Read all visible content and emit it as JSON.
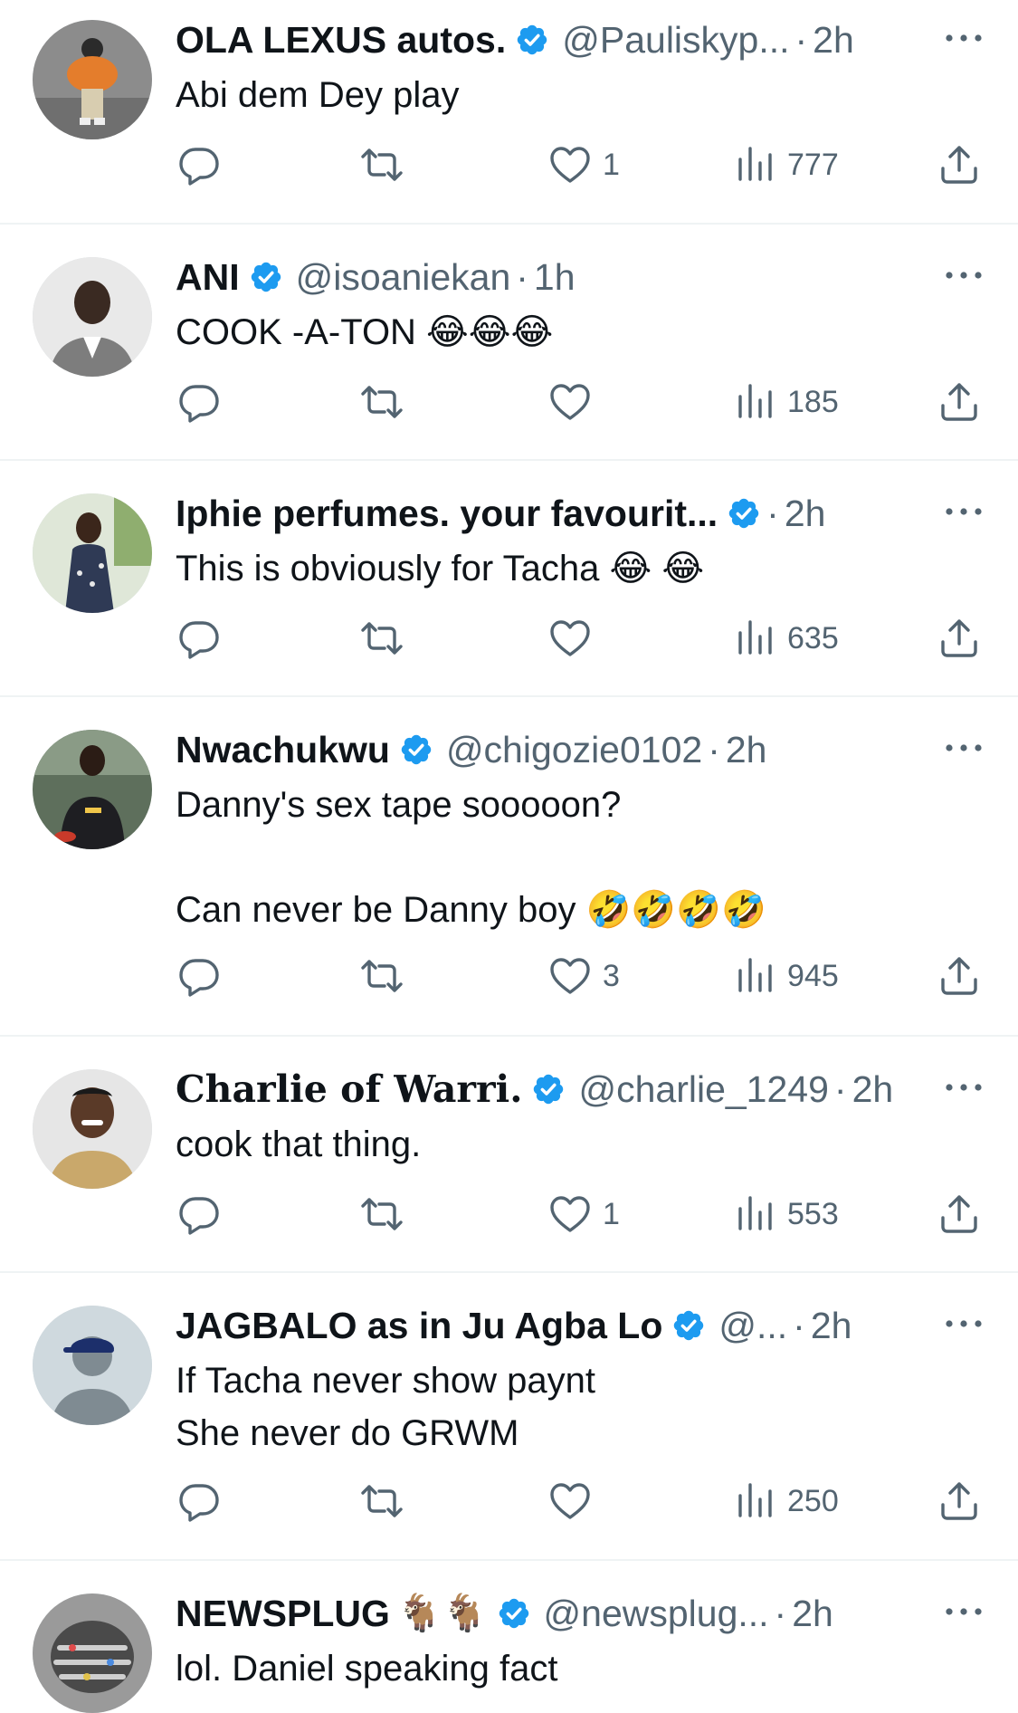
{
  "colors": {
    "verified": "#1d9bf0",
    "secondary_text": "#536471",
    "primary_text": "#0f1419",
    "divider": "#eff3f4"
  },
  "tweets": [
    {
      "name": "OLA LEXUS autos.",
      "verified": true,
      "handle": "@Pauliskyp...",
      "dot": "·",
      "time": "2h",
      "text": "Abi dem Dey play",
      "likes": "1",
      "views": "777",
      "avatar_icon": "toy-figure-avatar"
    },
    {
      "name": "ANI",
      "verified": true,
      "handle": "@isoaniekan",
      "dot": "·",
      "time": "1h",
      "text": "COOK -A-TON 😂😂😂",
      "likes": "",
      "views": "185",
      "avatar_icon": "man-portrait-avatar"
    },
    {
      "name": "Iphie perfumes. your favourit...",
      "verified": true,
      "handle": "",
      "dot": "·",
      "time": "2h",
      "text": "This is obviously for Tacha 😂 😂",
      "likes": "",
      "views": "635",
      "avatar_icon": "woman-portrait-avatar"
    },
    {
      "name": "Nwachukwu",
      "verified": true,
      "handle": "@chigozie0102",
      "dot": "·",
      "time": "2h",
      "text": "Danny's sex tape sooooon?\n\nCan never be Danny boy 🤣🤣🤣🤣",
      "likes": "3",
      "views": "945",
      "avatar_icon": "footballer-avatar"
    },
    {
      "name": "Charlie of Warri.",
      "verified": true,
      "handle": "@charlie_1249",
      "dot": "·",
      "time": "2h",
      "text": "cook that thing.",
      "likes": "1",
      "views": "553",
      "avatar_icon": "smiling-man-avatar"
    },
    {
      "name": "JAGBALO as in Ju Agba Lo",
      "verified": true,
      "handle": "@...",
      "dot": "·",
      "time": "2h",
      "text": "If Tacha never show paynt\nShe never do GRWM",
      "likes": "",
      "views": "250",
      "avatar_icon": "cap-avatar"
    },
    {
      "name": "NEWSPLUG",
      "name_suffix": "🐐🐐",
      "verified": true,
      "handle": "@newsplug...",
      "dot": "·",
      "time": "2h",
      "text": "lol. Daniel speaking fact",
      "avatar_icon": "hands-avatar"
    }
  ]
}
